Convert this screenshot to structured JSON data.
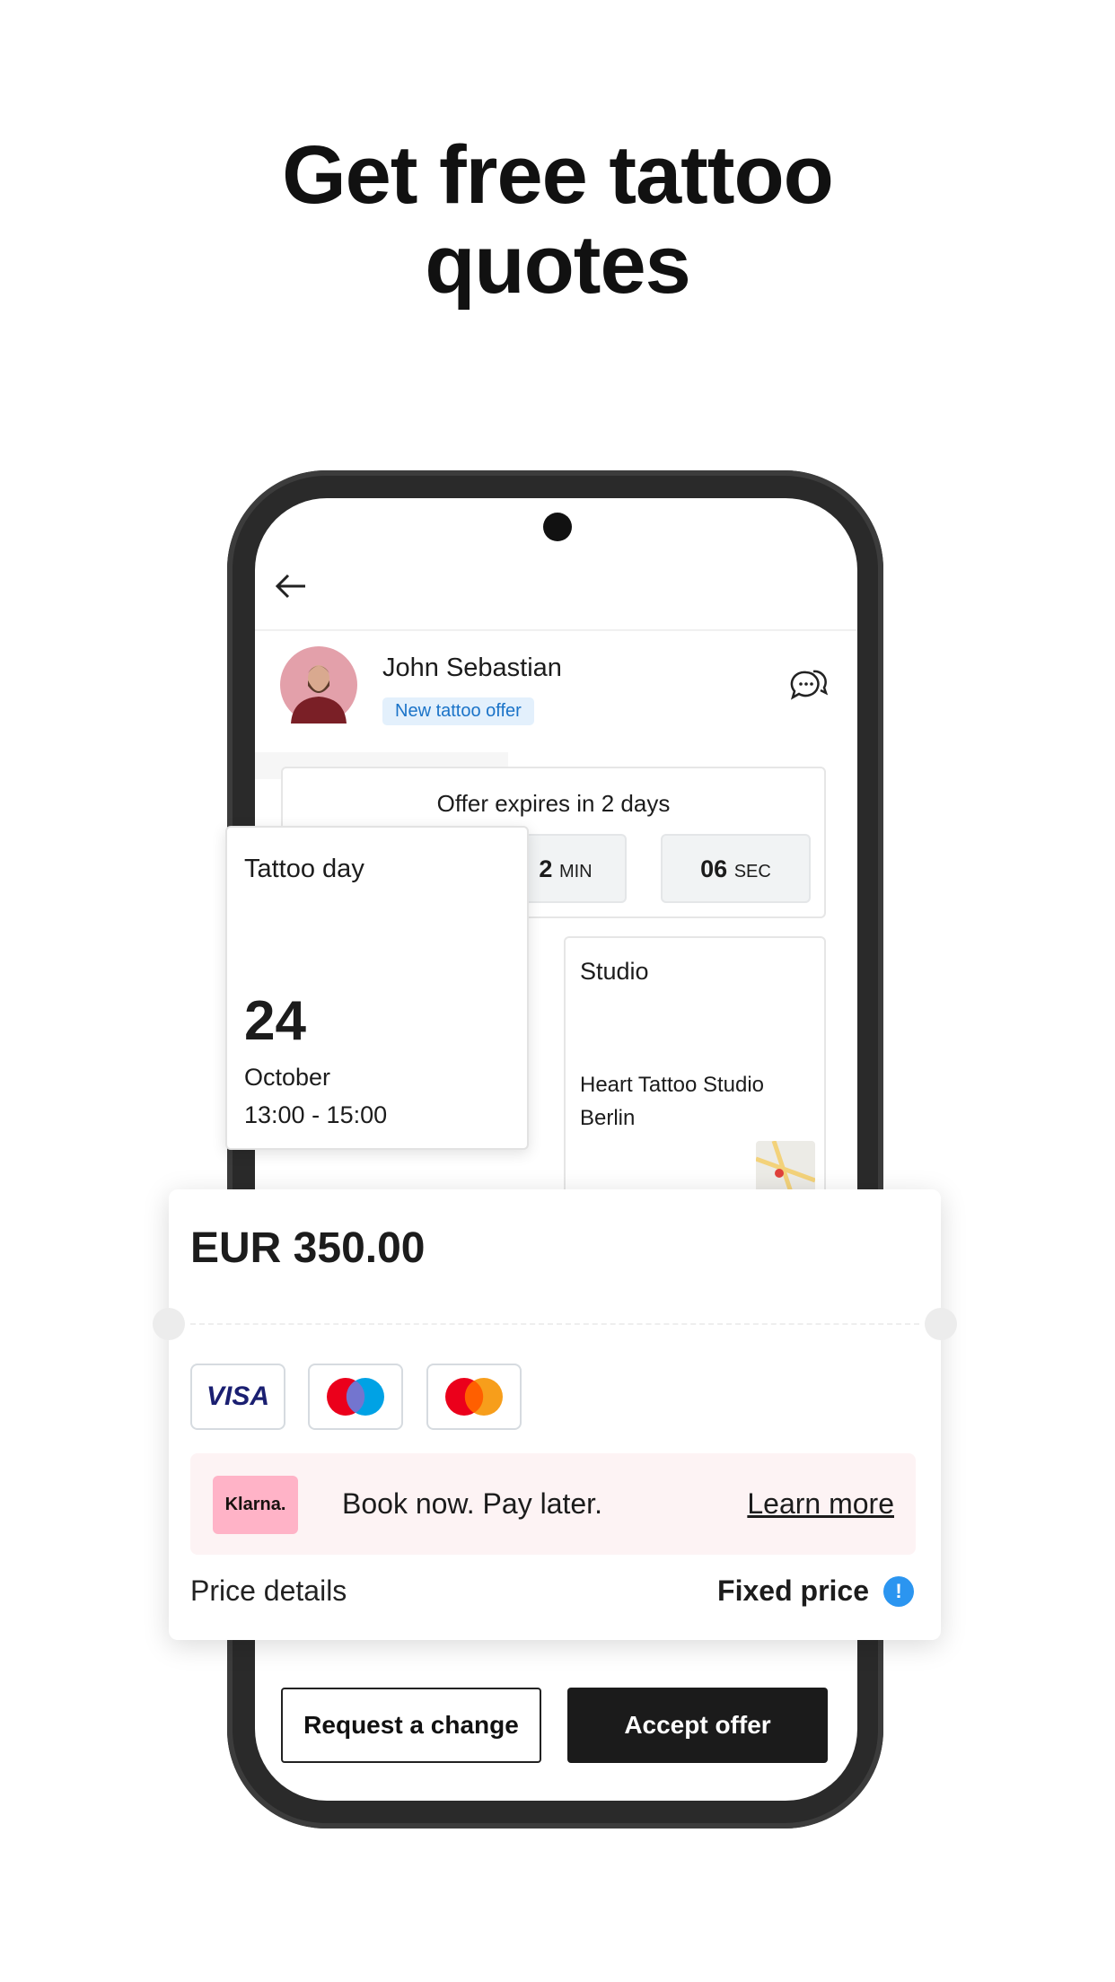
{
  "headline": {
    "line1": "Get free tattoo",
    "line2": "quotes"
  },
  "header": {
    "back_icon": "arrow-left-icon",
    "chat_icon": "chat-bubbles-icon"
  },
  "artist": {
    "name": "John Sebastian",
    "badge": "New tattoo offer"
  },
  "offer": {
    "expires_text": "Offer expires in 2 days",
    "minutes_value": "2",
    "minutes_unit": "MIN",
    "seconds_value": "06",
    "seconds_unit": "SEC"
  },
  "tattoo_day": {
    "label": "Tattoo day",
    "day": "24",
    "month": "October",
    "time": "13:00 - 15:00"
  },
  "studio": {
    "label": "Studio",
    "name": "Heart Tattoo Studio",
    "city": "Berlin"
  },
  "price": {
    "amount": "EUR 350.00",
    "details_label": "Price details",
    "type_label": "Fixed price"
  },
  "payment_methods": {
    "visa": "VISA"
  },
  "klarna": {
    "logo": "Klarna.",
    "text": "Book now. Pay later.",
    "link": "Learn more"
  },
  "actions": {
    "request_change": "Request a change",
    "accept": "Accept offer"
  },
  "colors": {
    "badge_bg": "#e3f0fc",
    "badge_text": "#1a73c8",
    "klarna_pink": "#ffb3c7",
    "klarna_band": "#fdf3f4",
    "info_blue": "#2b95f0",
    "accept_bg": "#1b1b1b"
  }
}
